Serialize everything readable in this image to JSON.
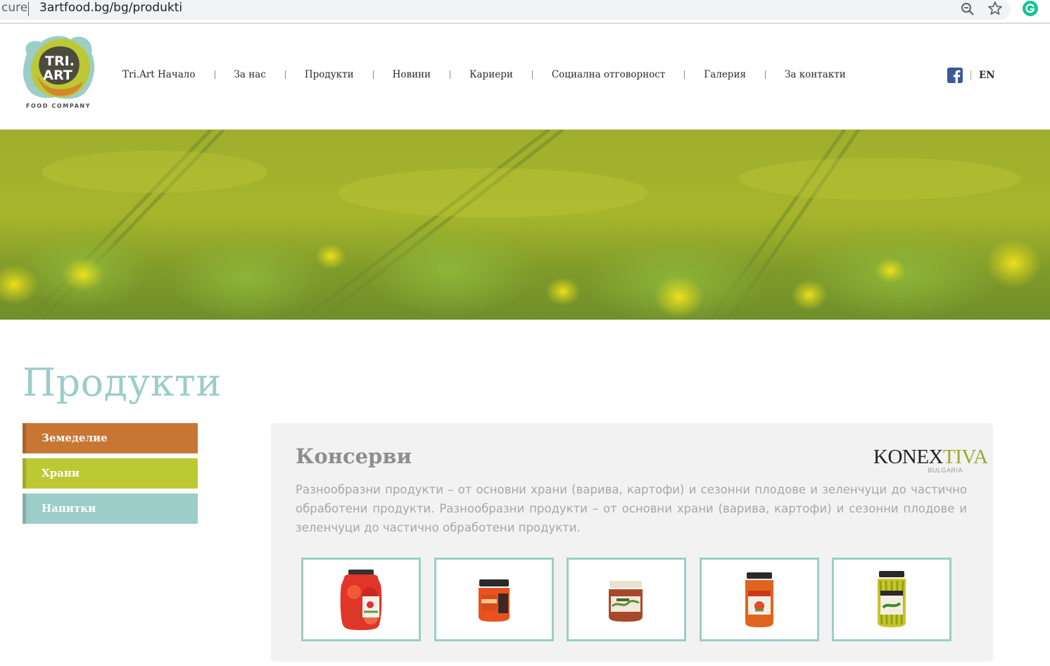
{
  "browser": {
    "url_prefix": "cure",
    "url": "3artfood.bg/bg/produkti"
  },
  "header": {
    "logo": {
      "line1": "TRI.",
      "line2": "ART",
      "tagline": "FOOD COMPANY"
    },
    "nav": [
      {
        "label": "Tri.Art Начало"
      },
      {
        "label": "За нас"
      },
      {
        "label": "Продукти"
      },
      {
        "label": "Новини"
      },
      {
        "label": "Кариери"
      },
      {
        "label": "Социална отговорност"
      },
      {
        "label": "Галерия"
      },
      {
        "label": "За контакти"
      }
    ],
    "lang_label": "EN"
  },
  "page": {
    "title": "Продукти"
  },
  "sidebar": {
    "items": [
      {
        "label": "Земеделие",
        "color": "#c87634"
      },
      {
        "label": "Храни",
        "color": "#bcc933"
      },
      {
        "label": "Напитки",
        "color": "#9ccdc8"
      }
    ]
  },
  "category": {
    "title": "Консерви",
    "brand": {
      "main_dark": "KONEX",
      "main_accent": "TIVA",
      "sub": "BULGARIA"
    },
    "description": "Разнообразни продукти – от основни храни (варива, картофи) и сезонни плодове и зеленчуци до частично обработени продукти. Разнообразни продукти – от основни храни (варива, картофи) и сезонни плодове и зеленчуци до частично обработени продукти."
  },
  "products": [
    {
      "icon": "jar-tomatoes-icon"
    },
    {
      "icon": "jar-red-pepper-icon"
    },
    {
      "icon": "jar-spread-icon"
    },
    {
      "icon": "jar-lyutenitsa-icon"
    },
    {
      "icon": "jar-green-peppers-icon"
    }
  ],
  "colors": {
    "accent_teal": "#9ccdc8",
    "accent_orange": "#c87634",
    "accent_lime": "#bcc933",
    "panel_bg": "#f2f2f3"
  }
}
